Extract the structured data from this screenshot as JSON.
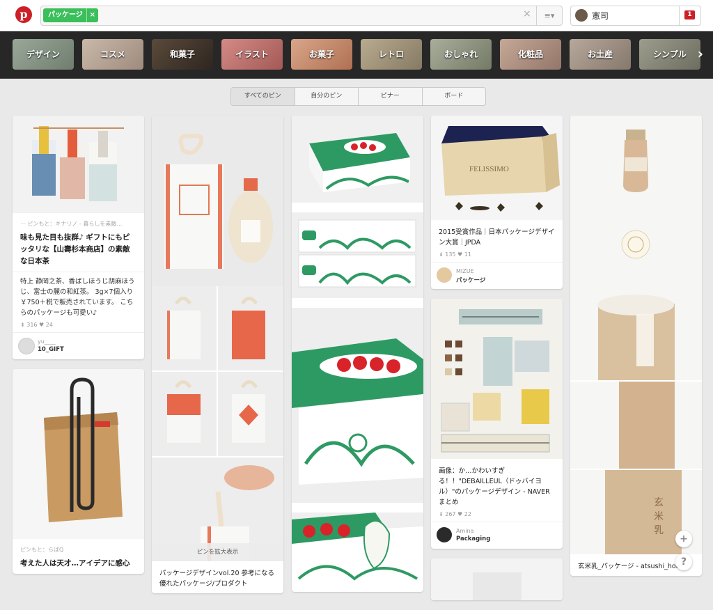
{
  "header": {
    "logo_glyph": "p",
    "search_tag": "パッケージ",
    "tag_remove": "×",
    "clear": "×",
    "menu_glyph": "≡▾",
    "user_name": "憲司",
    "notif_count": "1"
  },
  "categories": [
    "デザイン",
    "コスメ",
    "和菓子",
    "イラスト",
    "お菓子",
    "レトロ",
    "おしゃれ",
    "化粧品",
    "お土産",
    "シンプル"
  ],
  "category_arrow": "›",
  "tabs": [
    "すべてのピン",
    "自分のピン",
    "ピナー",
    "ボード"
  ],
  "pins": {
    "tea": {
      "source": "⋯ ピンもと：キナリノ - 暮らしを素敵…",
      "title": "味も見た目も抜群♪ ギフトにもピッタリな【山壽杉本商店】の素敵な日本茶",
      "desc": "特上 静岡之茶、香ばしほうじ胡麻ほうじ、富士の麓の和紅茶。 3g×7個入り ￥750＋税で販売されています。 こちらのパッケージも可愛い♪",
      "stats": "⇟ 316  ♥ 24",
      "pinner_name": "yu____",
      "pinner_board": "10_GIFT"
    },
    "bag": {
      "source": "ピンもと：らばQ",
      "title": "考えた人は天才…アイデアに感心"
    },
    "sake": {
      "zoom": "ピンを拡大表示",
      "title": "パッケージデザインvol.20 参考になる優れたパッケージ/プロダクト"
    },
    "felissimo": {
      "title": "2015受賞作品｜日本パッケージデザイン大賞｜JPDA",
      "stats": "⇟ 135  ♥ 11",
      "pinner_name": "MIZUE",
      "pinner_board": "パッケージ"
    },
    "chocolate": {
      "title": "画像：か…かわいすぎる！！\"DEBAILLEUL（ドゥバイヨル）\"のパッケージデザイン - NAVER まとめ",
      "stats": "⇟ 267  ♥ 22",
      "pinner_name": "Amina",
      "pinner_board": "Packaging"
    },
    "milk": {
      "title": "玄米乳_パッケージ - atsushi_honda"
    }
  },
  "fab": {
    "add": "+",
    "help": "?"
  },
  "colors": {
    "brand_red": "#cb2027",
    "tag_green": "#3bbf5a",
    "box_green": "#2e9a63",
    "straw": "#e07a52"
  }
}
